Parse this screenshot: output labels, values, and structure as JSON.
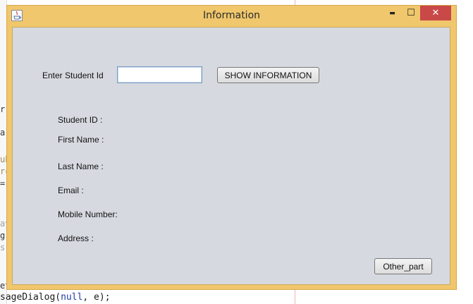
{
  "window": {
    "title": "Information",
    "controls": {
      "minimize": "▬",
      "maximize": "☐",
      "close": "✕"
    }
  },
  "form": {
    "student_id_label": "Enter Student Id",
    "student_id_value": "",
    "show_button_label": "SHOW INFORMATION",
    "other_button_label": "Other_part"
  },
  "fields": {
    "student_id": "Student ID :",
    "first_name": "First Name :",
    "last_name": "Last Name :",
    "email": "Email :",
    "mobile": "Mobile Number:",
    "address": "Address :"
  },
  "background_code": {
    "fragment_1": "r",
    "fragment_2": "a",
    "fragment_3": "ub",
    "fragment_4": "rc",
    "fragment_5": "=",
    "fragment_6": "ay",
    "fragment_7": "g",
    "fragment_8": "s",
    "fragment_9": "et",
    "bottom_line": "sageDialog(null, e);",
    "bottom_line_keyword": "null"
  }
}
